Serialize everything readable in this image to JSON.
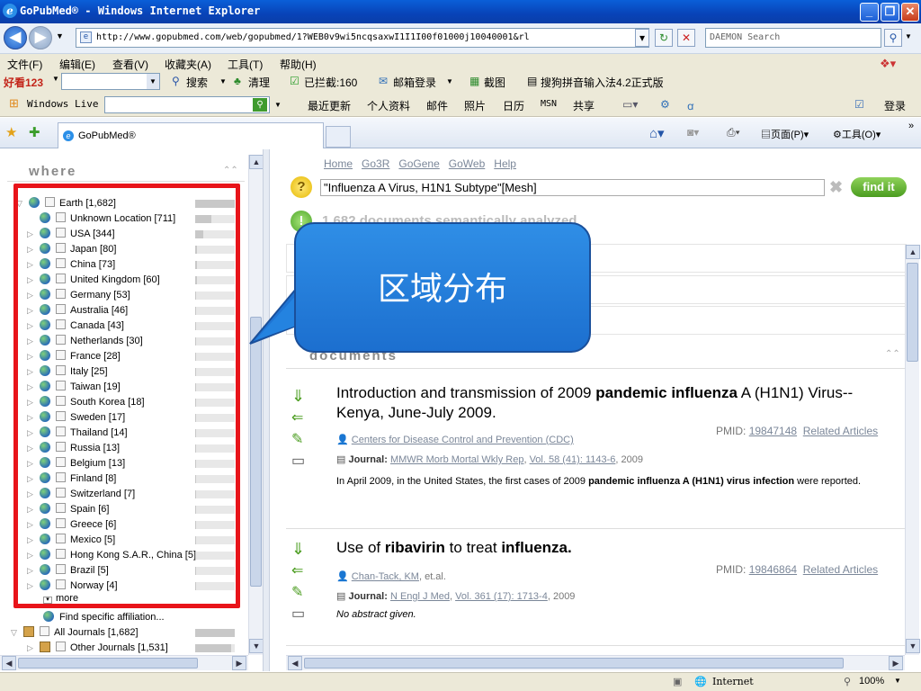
{
  "window": {
    "title": "GoPubMed® - Windows Internet Explorer"
  },
  "address": {
    "url": "http://www.gopubmed.com/web/gopubmed/1?WEB0v9wi5ncqsaxwI1I1I00f01000j10040001&rl",
    "search_placeholder": "DAEMON Search"
  },
  "menu": [
    "文件(F)",
    "编辑(E)",
    "查看(V)",
    "收藏夹(A)",
    "工具(T)",
    "帮助(H)"
  ],
  "toolbar1": {
    "brand": "好看123",
    "search": "搜索",
    "clean": "清理",
    "blocked": "已拦截:160",
    "mail": "邮箱登录",
    "screenshot": "截图",
    "ime": "搜狗拼音输入法4.2正式版"
  },
  "toolbar2": {
    "windows_live": "Windows Live",
    "items": [
      "最近更新",
      "个人资料",
      "邮件",
      "照片",
      "日历",
      "MSN",
      "共享"
    ],
    "login": "登录"
  },
  "tabs": {
    "active": "GoPubMed®",
    "page_menu": "页面(P)",
    "tools_menu": "工具(O)"
  },
  "left": {
    "section_title": "where",
    "root": "Earth [1,682]",
    "items": [
      {
        "label": "Unknown Location [711]",
        "fraction": 0.42
      },
      {
        "label": "USA [344]",
        "fraction": 0.2
      },
      {
        "label": "Japan [80]",
        "fraction": 0.05
      },
      {
        "label": "China [73]",
        "fraction": 0.04
      },
      {
        "label": "United Kingdom [60]",
        "fraction": 0.04
      },
      {
        "label": "Germany [53]",
        "fraction": 0.03
      },
      {
        "label": "Australia [46]",
        "fraction": 0.03
      },
      {
        "label": "Canada [43]",
        "fraction": 0.03
      },
      {
        "label": "Netherlands [30]",
        "fraction": 0.02
      },
      {
        "label": "France [28]",
        "fraction": 0.02
      },
      {
        "label": "Italy [25]",
        "fraction": 0.02
      },
      {
        "label": "Taiwan [19]",
        "fraction": 0.01
      },
      {
        "label": "South Korea [18]",
        "fraction": 0.01
      },
      {
        "label": "Sweden [17]",
        "fraction": 0.01
      },
      {
        "label": "Thailand [14]",
        "fraction": 0.01
      },
      {
        "label": "Russia [13]",
        "fraction": 0.01
      },
      {
        "label": "Belgium [13]",
        "fraction": 0.01
      },
      {
        "label": "Finland [8]",
        "fraction": 0.005
      },
      {
        "label": "Switzerland [7]",
        "fraction": 0.005
      },
      {
        "label": "Spain [6]",
        "fraction": 0.004
      },
      {
        "label": "Greece [6]",
        "fraction": 0.004
      },
      {
        "label": "Mexico [5]",
        "fraction": 0.003
      },
      {
        "label": "Hong Kong S.A.R., China [5]",
        "fraction": 0.003
      },
      {
        "label": "Brazil [5]",
        "fraction": 0.003
      },
      {
        "label": "Norway [4]",
        "fraction": 0.002
      }
    ],
    "more": "more",
    "find_affiliation": "Find specific affiliation...",
    "journals_root": "All Journals [1,682]",
    "other_journals": "Other Journals [1,531]"
  },
  "right": {
    "nav_links": [
      "Home",
      "Go3R",
      "GoGene",
      "GoWeb",
      "Help"
    ],
    "query": "\"Influenza A Virus, H1N1 Subtype\"[Mesh]",
    "find_button": "find it",
    "analyzed": "1,682 documents semantically analyzed",
    "documents_header": "documents",
    "callout": "区域分布",
    "docs": [
      {
        "title_pre": "Introduction and transmission of 2009 ",
        "title_bold": "pandemic influenza",
        "title_post": " A (H1N1) Virus--Kenya, June-July 2009.",
        "pmid_label": "PMID:",
        "pmid": "19847148",
        "related": "Related Articles",
        "author": "Centers for Disease Control and Prevention (CDC)",
        "author_suffix": "",
        "journal_label": "Journal:",
        "journal": "MMWR Morb Mortal Wkly Rep",
        "volume": "Vol. 58 (41): 1143-6",
        "year": ", 2009",
        "abstract_pre": "In April 2009, in the United States, the first cases of 2009 ",
        "abstract_bold": "pandemic influenza A (H1N1) virus infection",
        "abstract_post": " were reported."
      },
      {
        "title_pre": "Use of ",
        "title_bold": "ribavirin",
        "title_mid": " to treat ",
        "title_bold2": "influenza.",
        "pmid_label": "PMID:",
        "pmid": "19846864",
        "related": "Related Articles",
        "author": "Chan-Tack, KM",
        "author_suffix": ", et.al.",
        "journal_label": "Journal:",
        "journal": "N Engl J Med",
        "volume": "Vol. 361 (17): 1713-4",
        "year": ", 2009",
        "abstract": "No abstract given."
      }
    ]
  },
  "status": {
    "zone": "Internet",
    "zoom": "100%"
  }
}
